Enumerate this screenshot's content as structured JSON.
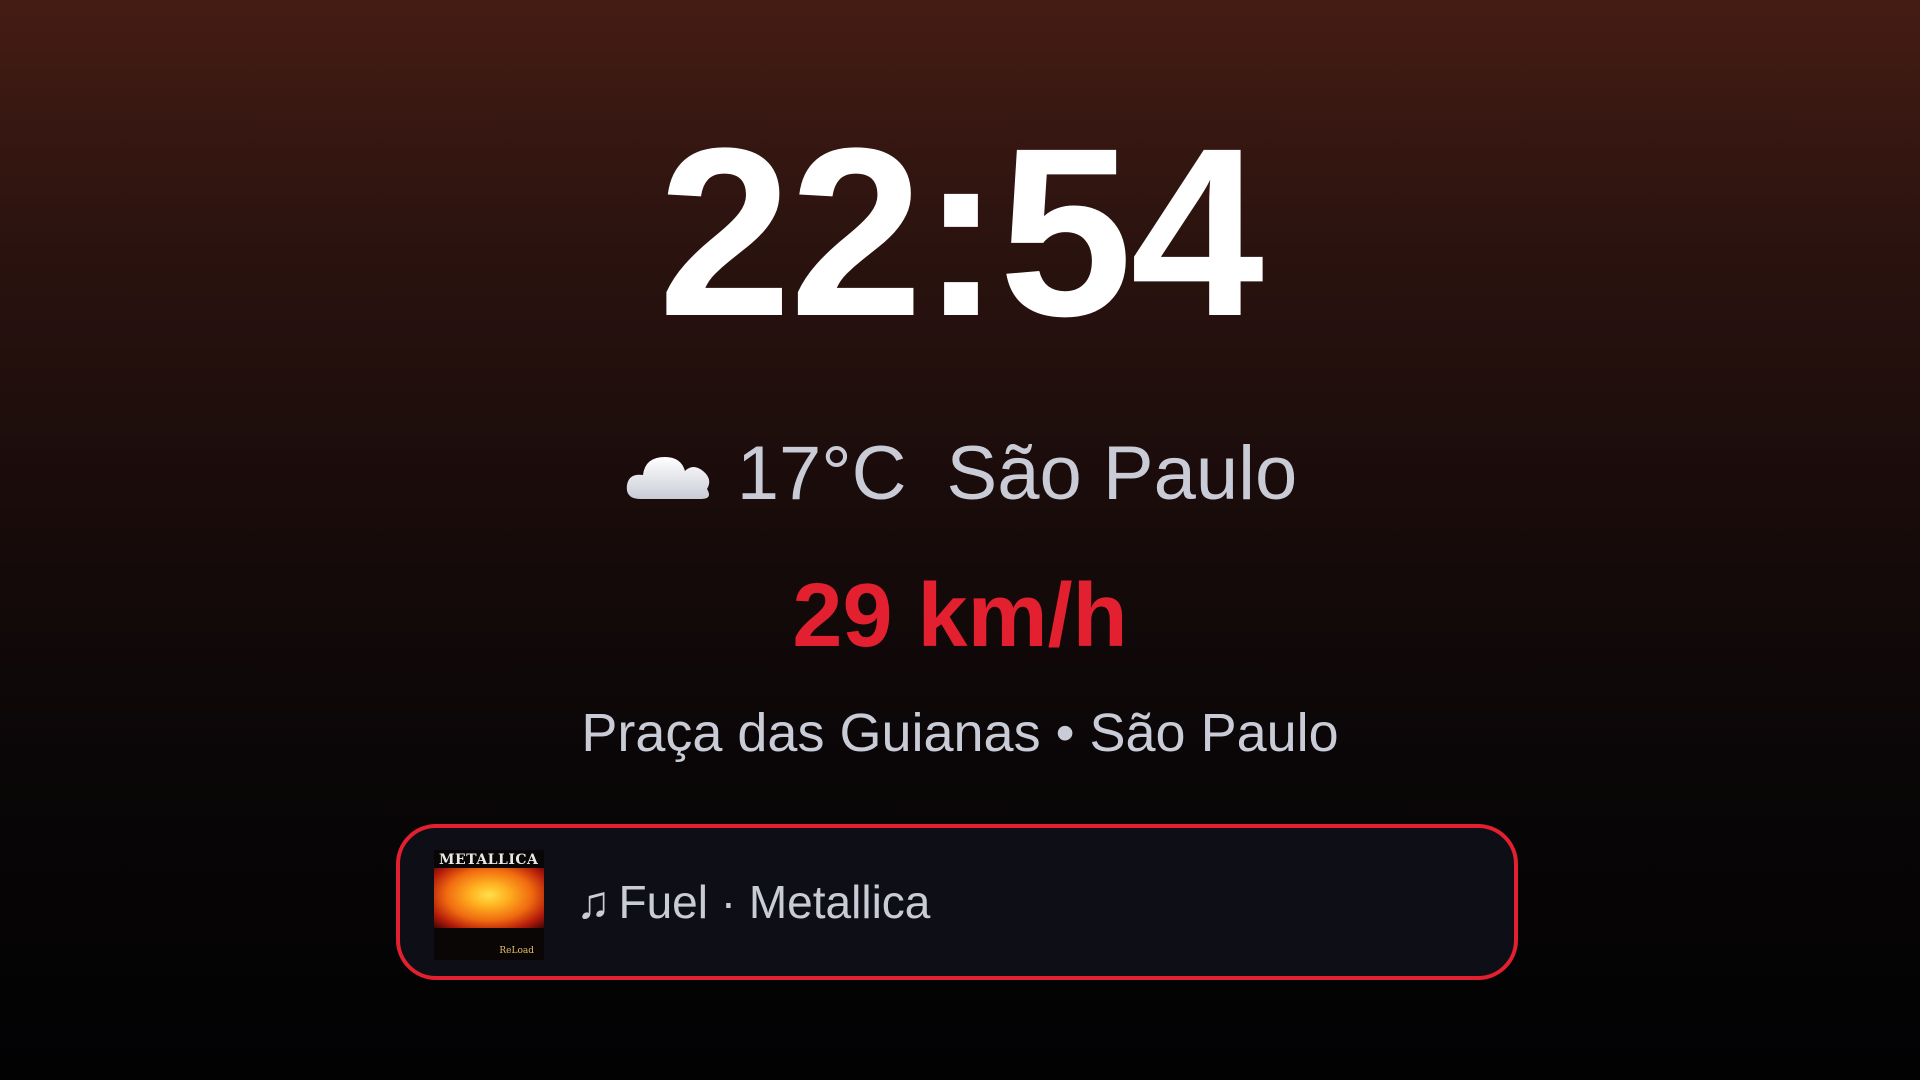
{
  "clock": {
    "time": "22:54"
  },
  "weather": {
    "icon": "cloud-icon",
    "temperature": "17°C",
    "city": "São Paulo"
  },
  "speed": {
    "value": "29 km/h",
    "color": "#e2202f"
  },
  "location": {
    "text": "Praça das Guianas • São Paulo"
  },
  "now_playing": {
    "note_glyph": "♫",
    "track_line": "Fuel · Metallica",
    "album_art": {
      "band_logo": "METALLICA",
      "subtitle": "ReLoad"
    },
    "border_color": "#e2202f"
  }
}
